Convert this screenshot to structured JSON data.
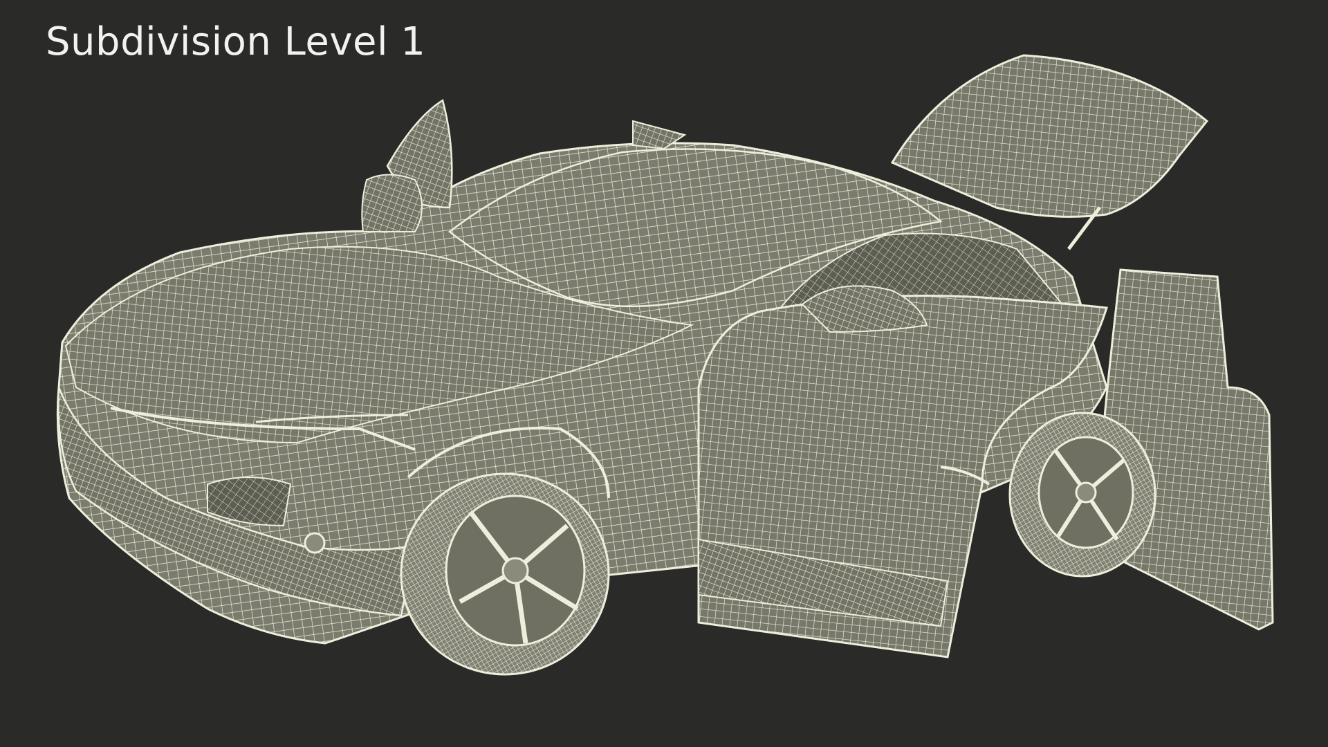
{
  "caption": {
    "text": "Subdivision Level 1"
  },
  "palette": {
    "background": "#2a2a28",
    "surface": "#7b7c6d",
    "surface_dark": "#66675a",
    "wire": "#eeeedc",
    "caption_text": "#f2f2f0"
  },
  "subject": {
    "icon": "wireframe-sports-car-icon"
  }
}
